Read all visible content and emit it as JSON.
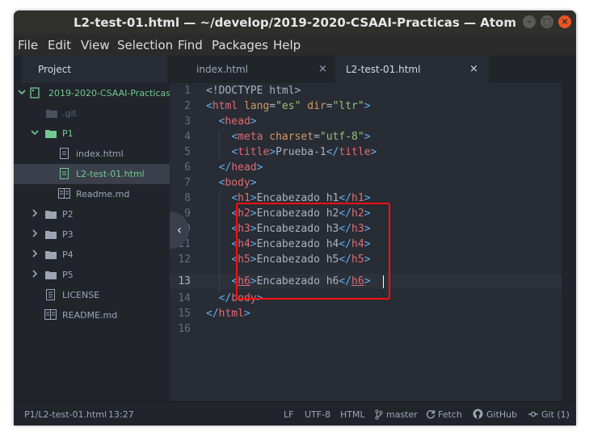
{
  "window": {
    "title": "L2-test-01.html — ~/develop/2019-2020-CSAAI-Practicas — Atom",
    "close_symbol": "×",
    "max_symbol": "□",
    "min_symbol": "–"
  },
  "menu": [
    "File",
    "Edit",
    "View",
    "Selection",
    "Find",
    "Packages",
    "Help"
  ],
  "sidebar": {
    "panel_tab": "Project",
    "tree": {
      "root": "2019-2020-CSAAI-Practicas",
      "git": ".git",
      "p1": "P1",
      "index": "index.html",
      "l2": "L2-test-01.html",
      "readme_md": "Readme.md",
      "p2": "P2",
      "p3": "P3",
      "p4": "P4",
      "p5": "P5",
      "license": "LICENSE",
      "readme": "README.md"
    }
  },
  "tabs": [
    {
      "label": "index.html",
      "close": "×"
    },
    {
      "label": "L2-test-01.html",
      "close": "×"
    }
  ],
  "editor": {
    "line_numbers": [
      "1",
      "2",
      "3",
      "4",
      "5",
      "6",
      "7",
      "8",
      "9",
      "10",
      "11",
      "12",
      "13",
      "14",
      "15",
      "16"
    ],
    "current_line": "13"
  },
  "status": {
    "file": "P1/L2-test-01.html",
    "cursor": "13:27",
    "line_ending": "LF",
    "encoding": "UTF-8",
    "grammar": "HTML",
    "branch": "master",
    "fetch": "Fetch",
    "github": "GitHub",
    "git": "Git (1)"
  },
  "colors": {
    "accent_green": "#73c990",
    "highlight_red": "#ff1010",
    "ubuntu_orange": "#e95420"
  }
}
